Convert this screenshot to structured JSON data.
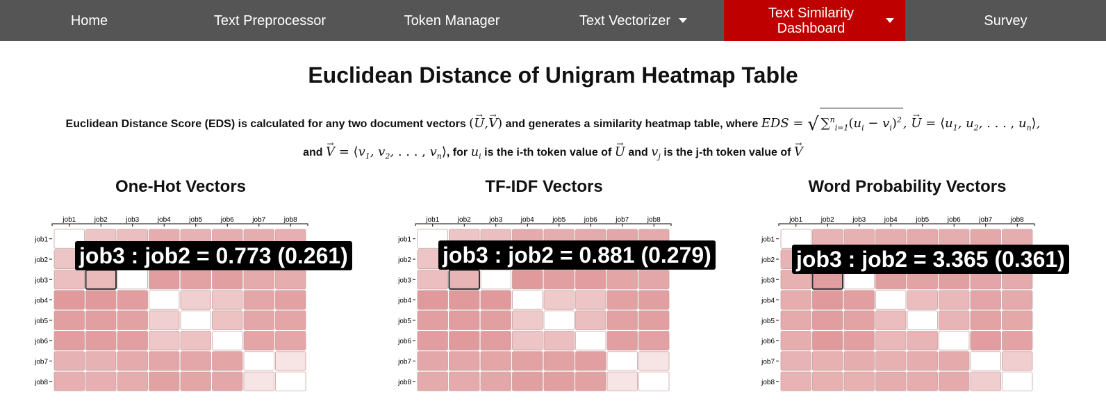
{
  "nav": {
    "items": [
      {
        "label": "Home",
        "dropdown": false,
        "active": false
      },
      {
        "label": "Text Preprocessor",
        "dropdown": false,
        "active": false
      },
      {
        "label": "Token Manager",
        "dropdown": false,
        "active": false
      },
      {
        "label": "Text Vectorizer",
        "dropdown": true,
        "active": false
      },
      {
        "label": "Text Similarity\nDashboard",
        "dropdown": true,
        "active": true
      },
      {
        "label": "Survey",
        "dropdown": false,
        "active": false
      }
    ],
    "bg_color": "#555555",
    "active_color": "#bf0000"
  },
  "page": {
    "title": "Euclidean Distance of Unigram Heatmap Table",
    "desc": {
      "p1": "Euclidean Distance Score (EDS) is calculated for any two document vectors",
      "p2": "and generates a similarity heatmap table, where",
      "p3": "and",
      "p4": ", for",
      "p5": "is the i-th token value of",
      "p6": "and",
      "p7": "is the j-th token value of"
    }
  },
  "panels": [
    {
      "title": "One-Hot Vectors",
      "tooltip": "job3 : job2 = 0.773 (0.261)",
      "chart_data": {
        "type": "heatmap",
        "rows": [
          "job1",
          "job2",
          "job3",
          "job4",
          "job5",
          "job6",
          "job7",
          "job8"
        ],
        "cols": [
          "job1",
          "job2",
          "job3",
          "job4",
          "job5",
          "job6",
          "job7",
          "job8"
        ],
        "values": [
          [
            0.0,
            0.22,
            0.24,
            0.31,
            0.29,
            0.31,
            0.31,
            0.3
          ],
          [
            0.22,
            0.0,
            0.26,
            0.38,
            0.36,
            0.37,
            0.29,
            0.3
          ],
          [
            0.24,
            0.26,
            0.0,
            0.37,
            0.35,
            0.36,
            0.32,
            0.31
          ],
          [
            0.38,
            0.38,
            0.37,
            0.0,
            0.18,
            0.21,
            0.33,
            0.35
          ],
          [
            0.36,
            0.36,
            0.35,
            0.18,
            0.0,
            0.23,
            0.33,
            0.34
          ],
          [
            0.37,
            0.37,
            0.36,
            0.21,
            0.23,
            0.0,
            0.34,
            0.33
          ],
          [
            0.29,
            0.29,
            0.32,
            0.33,
            0.33,
            0.34,
            0.0,
            0.1
          ],
          [
            0.3,
            0.3,
            0.31,
            0.35,
            0.34,
            0.33,
            0.1,
            0.0
          ]
        ],
        "highlight": {
          "row": "job3",
          "col": "job2"
        }
      }
    },
    {
      "title": "TF-IDF Vectors",
      "tooltip": "job3 : job2 = 0.881 (0.279)",
      "chart_data": {
        "type": "heatmap",
        "rows": [
          "job1",
          "job2",
          "job3",
          "job4",
          "job5",
          "job6",
          "job7",
          "job8"
        ],
        "cols": [
          "job1",
          "job2",
          "job3",
          "job4",
          "job5",
          "job6",
          "job7",
          "job8"
        ],
        "values": [
          [
            0.0,
            0.22,
            0.24,
            0.32,
            0.31,
            0.32,
            0.33,
            0.32
          ],
          [
            0.22,
            0.0,
            0.28,
            0.38,
            0.37,
            0.38,
            0.33,
            0.32
          ],
          [
            0.24,
            0.28,
            0.0,
            0.38,
            0.36,
            0.37,
            0.34,
            0.33
          ],
          [
            0.38,
            0.38,
            0.38,
            0.0,
            0.2,
            0.22,
            0.35,
            0.36
          ],
          [
            0.36,
            0.37,
            0.36,
            0.2,
            0.0,
            0.24,
            0.35,
            0.36
          ],
          [
            0.37,
            0.38,
            0.37,
            0.22,
            0.24,
            0.0,
            0.36,
            0.35
          ],
          [
            0.33,
            0.33,
            0.34,
            0.35,
            0.35,
            0.36,
            0.0,
            0.1
          ],
          [
            0.32,
            0.32,
            0.33,
            0.36,
            0.36,
            0.35,
            0.1,
            0.0
          ]
        ],
        "highlight": {
          "row": "job3",
          "col": "job2"
        }
      }
    },
    {
      "title": "Word Probability Vectors",
      "tooltip": "job3 : job2 = 3.365 (0.361)",
      "chart_data": {
        "type": "heatmap",
        "rows": [
          "job1",
          "job2",
          "job3",
          "job4",
          "job5",
          "job6",
          "job7",
          "job8"
        ],
        "cols": [
          "job1",
          "job2",
          "job3",
          "job4",
          "job5",
          "job6",
          "job7",
          "job8"
        ],
        "values": [
          [
            0.0,
            0.28,
            0.29,
            0.3,
            0.31,
            0.3,
            0.32,
            0.3
          ],
          [
            0.28,
            0.0,
            0.36,
            0.37,
            0.36,
            0.37,
            0.33,
            0.32
          ],
          [
            0.29,
            0.36,
            0.0,
            0.35,
            0.34,
            0.35,
            0.33,
            0.31
          ],
          [
            0.3,
            0.37,
            0.35,
            0.0,
            0.24,
            0.26,
            0.33,
            0.31
          ],
          [
            0.31,
            0.36,
            0.34,
            0.24,
            0.0,
            0.27,
            0.34,
            0.32
          ],
          [
            0.3,
            0.37,
            0.35,
            0.26,
            0.27,
            0.0,
            0.36,
            0.34
          ],
          [
            0.28,
            0.29,
            0.3,
            0.29,
            0.3,
            0.31,
            0.0,
            0.18
          ],
          [
            0.28,
            0.29,
            0.29,
            0.3,
            0.3,
            0.31,
            0.18,
            0.0
          ]
        ],
        "highlight": {
          "row": "job3",
          "col": "job2"
        }
      }
    }
  ],
  "colors": {
    "heat_max": "#e09a9c",
    "heat_min": "#ffffff",
    "cell_stroke": "#c9a0a0",
    "highlight_stroke": "#333333",
    "tooltip_bg": "#000000",
    "tooltip_fg": "#ffffff"
  }
}
